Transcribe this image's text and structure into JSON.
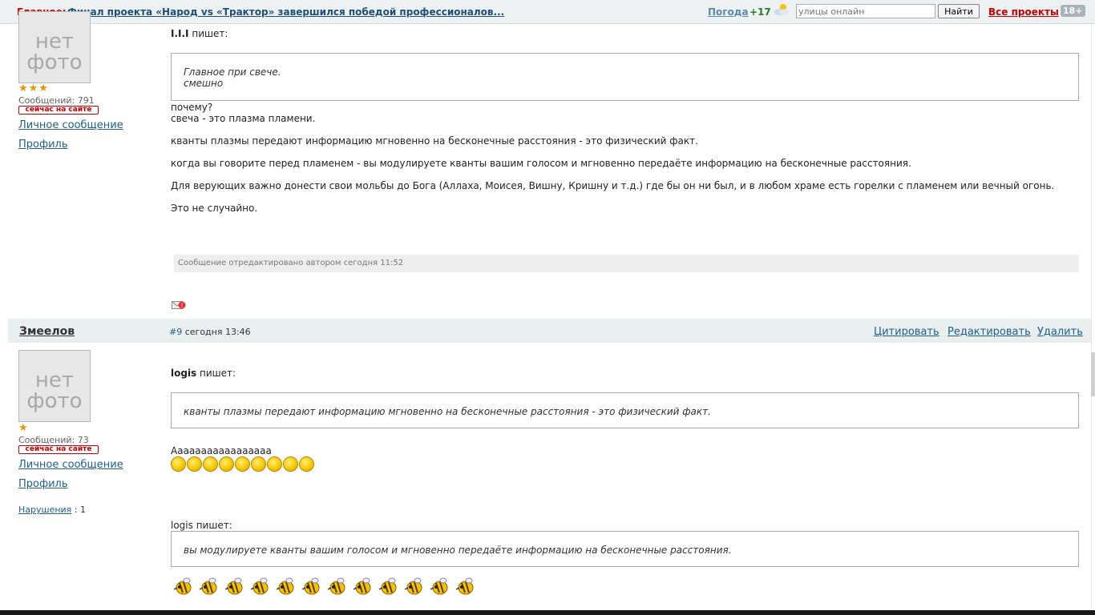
{
  "topbar": {
    "main_label": "Главное:",
    "main_link": "Финал проекта «Народ vs «Трактор» завершился победой профессионалов...",
    "weather_label": "Погода",
    "temperature": "+17",
    "search_placeholder": "улицы онлайн",
    "find_button": "Найти",
    "all_projects": "Все проекты",
    "age_badge": "18+"
  },
  "icons": {
    "weather": "cloud-sun-icon",
    "mail": "mail-icon",
    "smiley": "smiley-icon",
    "bee": "bee-icon"
  },
  "post1": {
    "avatar_text_1": "нет",
    "avatar_text_2": "фото",
    "stars": 3,
    "stars_glyph": "★★★",
    "messages_count": "Сообщений: 791",
    "online": "сейчас на сайте",
    "private_message": "Личное сообщение",
    "profile": "Профиль",
    "quote_author": "I.I.I",
    "writes": "пишет:",
    "quote_lines": [
      "Главное при свече.",
      "смешно"
    ],
    "text_lines": [
      "почему?",
      "свеча - это плазма пламени.",
      "кванты плазмы передают информацию мгновенно на бесконечные расстояния - это физический факт.",
      "когда вы говорите перед пламенем - вы модулируете кванты вашим голосом и мгновенно передаёте информацию на бесконечные расстояния.",
      "Для верующих важно донести свои мольбы до Бога (Аллаха, Моисея, Вишну, Кришну и т.д.) где бы он ни был, и в любом храме есть горелки с пламенем или вечный огонь.",
      "Это не случайно."
    ],
    "edited_note": "Сообщение отредактировано автором сегодня 11:52"
  },
  "post2": {
    "author": "Змеелов",
    "post_number": "#9",
    "timestamp": "сегодня 13:46",
    "actions": {
      "quote": "Цитировать",
      "edit": "Редактировать",
      "delete": "Удалить"
    },
    "avatar_text_1": "нет",
    "avatar_text_2": "фото",
    "stars": 1,
    "stars_glyph": "★",
    "messages_count": "Сообщений: 73",
    "online": "сейчас на сайте",
    "private_message": "Личное сообщение",
    "profile": "Профиль",
    "violations_label": "Нарушения",
    "violations_count": ": 1",
    "quote1_author": "logis",
    "writes": "пишет:",
    "quote1_text": "кванты плазмы передают информацию мгновенно на бесконечные расстояния - это физический факт.",
    "reply1": "Ааааааааааааааааа",
    "smiley_count": 9,
    "quote2_header": "logis пишет:",
    "quote2_text": "вы модулируете кванты вашим голосом и мгновенно передаёте информацию на бесконечные расстояния.",
    "bee_count": 12
  },
  "colors": {
    "accent_red": "#cc0000",
    "link_blue": "#1f5f8b",
    "star_orange": "#e99400"
  }
}
